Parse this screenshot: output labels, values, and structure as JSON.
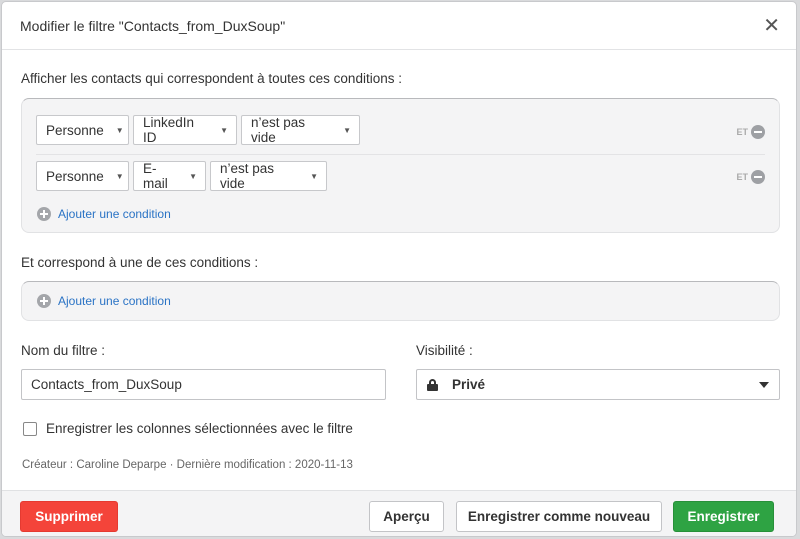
{
  "dialog": {
    "title": "Modifier le filtre \"Contacts_from_DuxSoup\"",
    "close_icon": "close-icon"
  },
  "all_conditions": {
    "label": "Afficher les contacts qui correspondent à toutes ces conditions :",
    "rows": [
      {
        "entity": "Personne",
        "field": "LinkedIn ID",
        "operator": "n’est pas vide",
        "connector": "ET"
      },
      {
        "entity": "Personne",
        "field": "E-mail",
        "operator": "n’est pas vide",
        "connector": "ET"
      }
    ],
    "add_label": "Ajouter une condition"
  },
  "any_conditions": {
    "label": "Et correspond à une de ces conditions :",
    "add_label": "Ajouter une condition"
  },
  "filter_name": {
    "label": "Nom du filtre :",
    "value": "Contacts_from_DuxSoup"
  },
  "visibility": {
    "label": "Visibilité :",
    "value": "Privé",
    "icon": "lock-icon"
  },
  "save_columns": {
    "label": "Enregistrer les colonnes sélectionnées avec le filtre",
    "checked": false
  },
  "meta": {
    "text": "Créateur : Caroline Deparpe · Dernière modification : 2020-11-13"
  },
  "footer": {
    "delete_label": "Supprimer",
    "preview_label": "Aperçu",
    "save_new_label": "Enregistrer comme nouveau",
    "save_label": "Enregistrer"
  },
  "colors": {
    "danger": "#f4443a",
    "primary": "#2ea343",
    "link": "#2a73c5"
  }
}
